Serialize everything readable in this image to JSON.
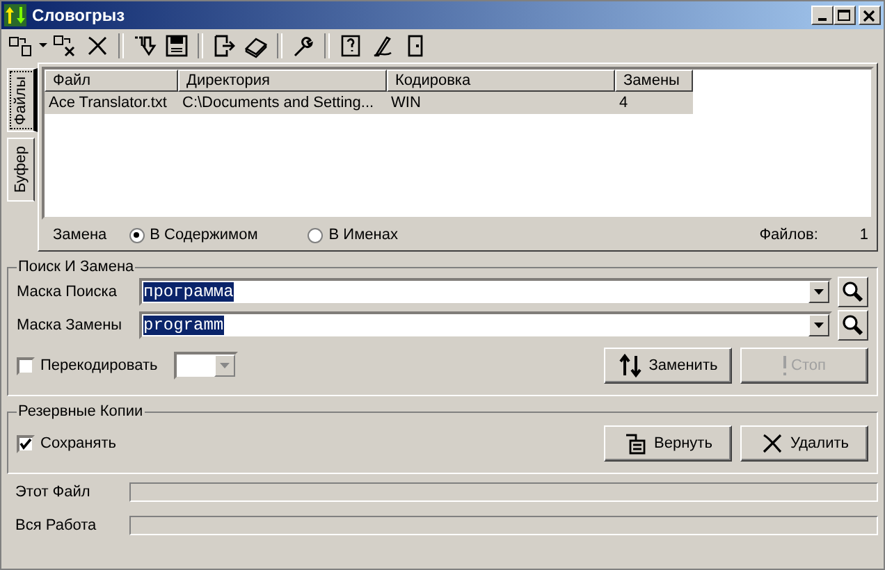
{
  "window": {
    "title": "Словогрыз"
  },
  "side_tabs": [
    {
      "label": "Файлы",
      "selected": true
    },
    {
      "label": "Буфер",
      "selected": false
    }
  ],
  "table": {
    "columns": [
      "Файл",
      "Директория",
      "Кодировка",
      "Замены"
    ],
    "rows": [
      {
        "cells": [
          "Ace Translator.txt",
          "C:\\Documents and Setting...",
          "WIN",
          "4"
        ],
        "selected": true
      }
    ]
  },
  "replace_in": {
    "label": "Замена",
    "options": [
      {
        "label": "В Содержимом",
        "selected": true
      },
      {
        "label": "В Именах",
        "selected": false
      }
    ]
  },
  "files_count": {
    "label": "Файлов:",
    "value": "1"
  },
  "search_group": {
    "title": "Поиск И Замена",
    "fields": [
      {
        "label": "Маска Поиска",
        "value": "программа"
      },
      {
        "label": "Маска Замены",
        "value": "programm"
      }
    ],
    "recode": {
      "label": "Перекодировать",
      "checked": false
    },
    "buttons": [
      {
        "label": "Заменить",
        "kind": "replace",
        "disabled": false
      },
      {
        "label": "Стоп",
        "kind": "stop",
        "disabled": true
      }
    ]
  },
  "backup_group": {
    "title": "Резервные Копии",
    "save": {
      "label": "Сохранять",
      "checked": true
    },
    "buttons": [
      {
        "label": "Вернуть",
        "kind": "restore",
        "disabled": false
      },
      {
        "label": "Удалить",
        "kind": "delete",
        "disabled": false
      }
    ]
  },
  "progress": [
    {
      "label": "Этот Файл",
      "level": 0
    },
    {
      "label": "Вся Работа",
      "level": 0
    }
  ]
}
